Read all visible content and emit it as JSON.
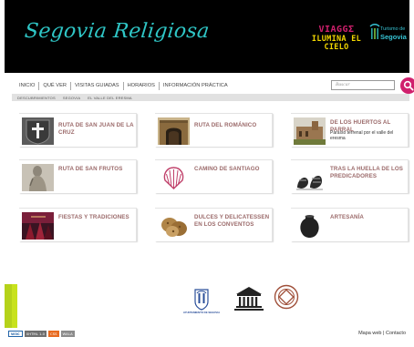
{
  "header": {
    "logo_text": "Segovia Religiosa",
    "promo_top": "VIAGGΣ",
    "promo_bottom": "ILUMINA EL CIELO",
    "tourism_line1": "Turismo de",
    "tourism_line2": "Segovia"
  },
  "nav": {
    "items": [
      "INICIO",
      "QUÉ VER",
      "VISITAS GUIADAS",
      "HORARIOS",
      "INFORMACIÓN PRÁCTICA"
    ],
    "search_placeholder": "Buscar"
  },
  "crumbs": [
    "DESCUBRIMIENTOS",
    "SEGOVIA",
    "EL VALLE DEL ERESMA"
  ],
  "cards": [
    {
      "title": "RUTA DE SAN JUAN DE LA CRUZ",
      "subtitle": "",
      "icon": "cross-emblem-icon"
    },
    {
      "title": "RUTA DEL ROMÁNICO",
      "subtitle": "",
      "icon": "romanesque-church-icon"
    },
    {
      "title": "DE LOS HUERTOS AL PARRAL",
      "subtitle": "Paraíso terrenal por el valle del eresma",
      "icon": "monastery-icon"
    },
    {
      "title": "RUTA DE SAN FRUTOS",
      "subtitle": "",
      "icon": "stone-statue-icon"
    },
    {
      "title": "CAMINO DE SANTIAGO",
      "subtitle": "",
      "icon": "scallop-shell-icon"
    },
    {
      "title": "TRAS LA HUELLA DE LOS PREDICADORES",
      "subtitle": "",
      "icon": "sandals-icon"
    },
    {
      "title": "FIESTAS Y TRADICIONES",
      "subtitle": "",
      "icon": "procession-icon"
    },
    {
      "title": "DULCES Y DELICATESSEN EN LOS CONVENTOS",
      "subtitle": "",
      "icon": "pastries-icon"
    },
    {
      "title": "ARTESANÍA",
      "subtitle": "",
      "icon": "clay-pot-icon"
    }
  ],
  "partners": {
    "ayto_label": "AYUNTAMIENTO DE SEGOVIA"
  },
  "footer": {
    "badges": [
      "W3C",
      "XHTML 1.0",
      "CSS",
      "WAI-A"
    ],
    "sitemap": "Mapa web",
    "separator": "|",
    "contact": "Contacto"
  },
  "colors": {
    "header_bg": "#000000",
    "logo": "#2fc6c6",
    "accent_pink": "#d0206d",
    "lime_band": "#c8e21d",
    "card_title": "#9b6a6a"
  }
}
